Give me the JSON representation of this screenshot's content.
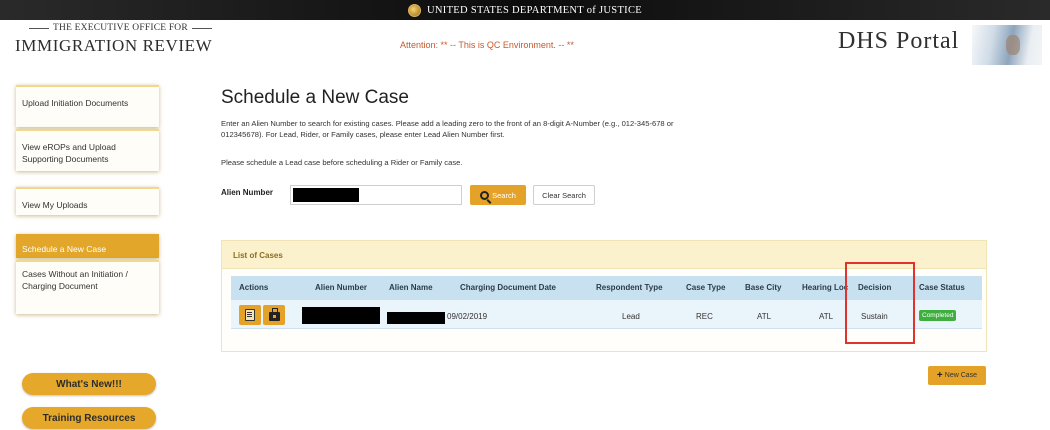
{
  "banner": {
    "department": "UNITED STATES DEPARTMENT of JUSTICE"
  },
  "header": {
    "agency_small": "THE EXECUTIVE OFFICE FOR",
    "agency_big": "IMMIGRATION REVIEW",
    "attention": "Attention: ** -- This is QC Environment. -- **",
    "portal_title": "DHS Portal"
  },
  "sidebar": {
    "items": [
      {
        "label": "Upload Initiation Documents"
      },
      {
        "label": "View eROPs and Upload Supporting Documents"
      },
      {
        "label": "View My Uploads"
      },
      {
        "label": "Schedule a New Case",
        "active": true
      },
      {
        "label": "Cases Without an Initiation / Charging Document"
      }
    ],
    "whats_new": "What's New!!!",
    "training": "Training Resources"
  },
  "main": {
    "title": "Schedule a New Case",
    "intro": "Enter an Alien Number to search for existing cases. Please add a leading zero to the front of an 8-digit A-Number (e.g., 012-345-678 or 012345678). For Lead, Rider, or Family cases, please enter Lead Alien Number first.",
    "intro2": "Please schedule a Lead case before scheduling a Rider or Family case.",
    "search": {
      "label": "Alien Number",
      "value": "",
      "button": "Search",
      "clear": "Clear Search"
    },
    "list": {
      "title": "List of Cases",
      "columns": [
        "Actions",
        "Alien Number",
        "Alien Name",
        "Charging Document Date",
        "Respondent Type",
        "Case Type",
        "Base City",
        "Hearing Loc",
        "Decision",
        "Case Status"
      ],
      "rows": [
        {
          "alien_number": "",
          "alien_name": "",
          "charging_document_date": "09/02/2019",
          "respondent_type": "Lead",
          "case_type": "REC",
          "base_city": "ATL",
          "hearing_loc": "ATL",
          "decision": "Sustain",
          "case_status": "Completed"
        }
      ]
    },
    "new_case": "New Case"
  },
  "colors": {
    "accent": "#e5a228",
    "header_blue": "#c7e1f1",
    "highlight": "#e0332e",
    "status_green": "#3fae3f"
  },
  "icons": [
    "seal-icon",
    "search-icon",
    "document-icon",
    "briefcase-icon",
    "plus-icon"
  ]
}
